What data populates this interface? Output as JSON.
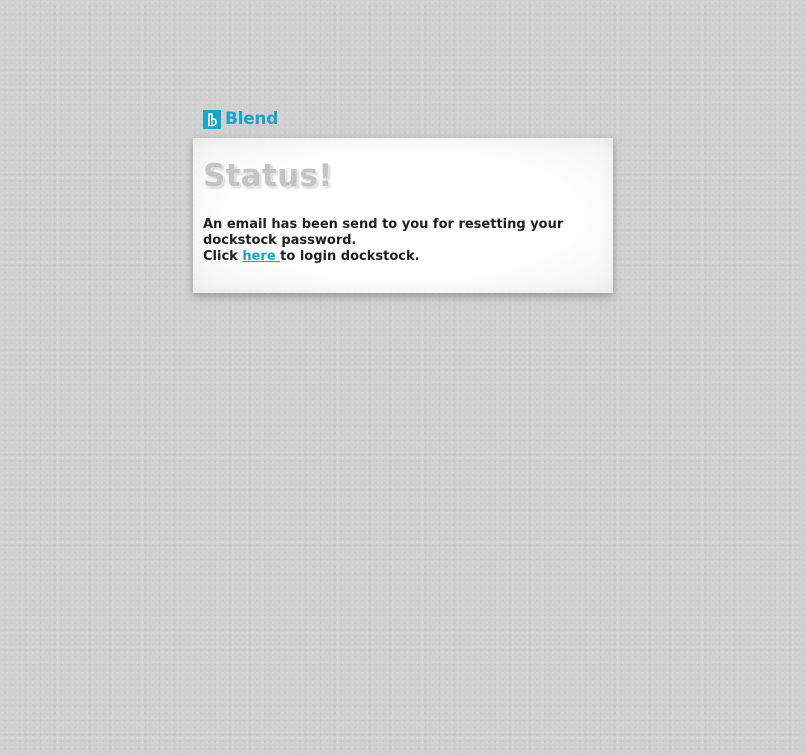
{
  "brand": {
    "name": "Blend",
    "logo_icon": "blend-logo-icon",
    "color": "#1aa3c8"
  },
  "panel": {
    "title": "Status!",
    "message_line1": "An email has been send to you for resetting your dockstock password.",
    "click_prefix": "Click ",
    "link_text": "here ",
    "click_suffix": "to login dockstock."
  },
  "colors": {
    "background": "#cfcfcf",
    "title": "#c4c4c4",
    "text": "#1e1e1e",
    "link": "#1aa3c8"
  }
}
